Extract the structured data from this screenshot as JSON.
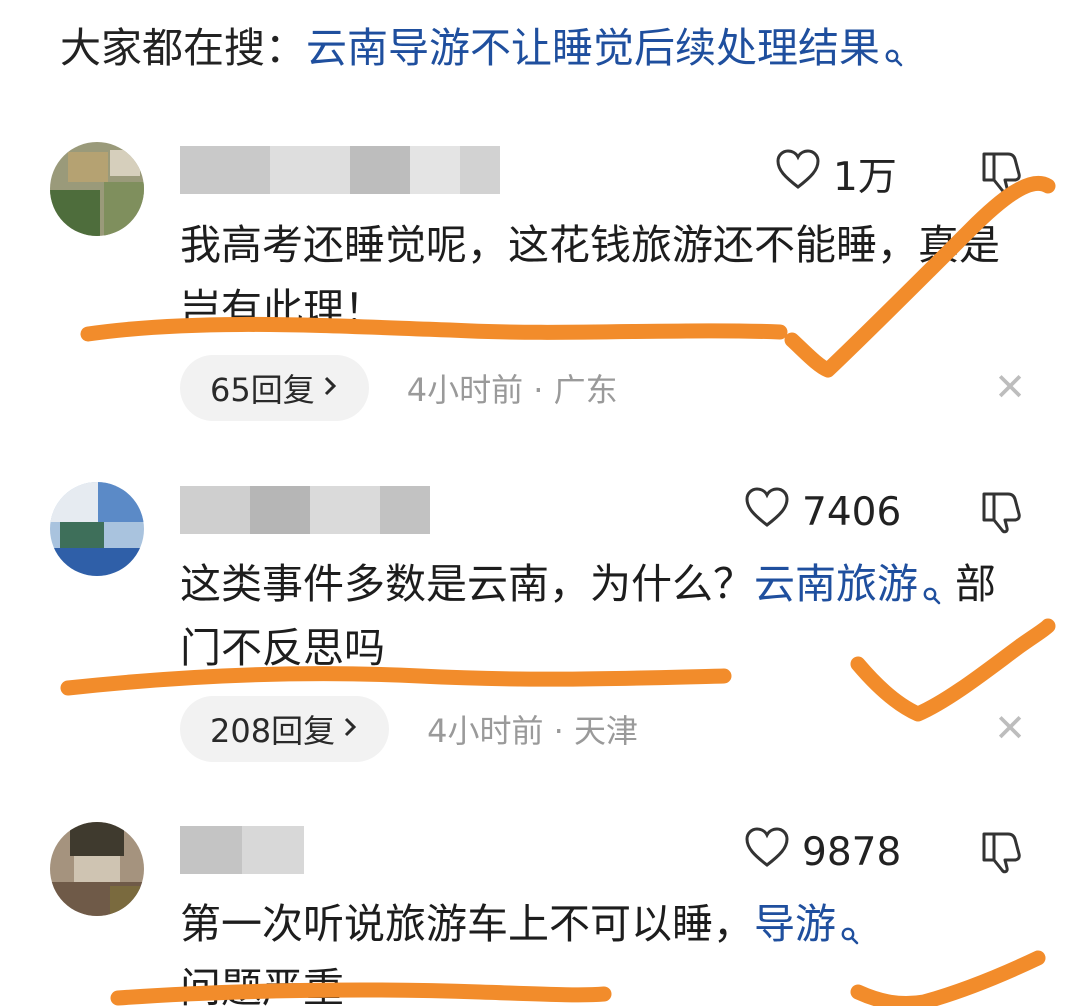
{
  "trending": {
    "prefix": "大家都在搜：",
    "query": "云南导游不让睡觉后续处理结果"
  },
  "comments": [
    {
      "likes": "1万",
      "text": "我高考还睡觉呢，这花钱旅游还不能睡，真是岂有此理！",
      "reply_label": "65回复",
      "time": "4小时前",
      "location": "广东",
      "avatar_colors": [
        "#9a9a7a",
        "#7f8f5d",
        "#b5a272",
        "#4e6d3c",
        "#d6cfbc"
      ]
    },
    {
      "likes": "7406",
      "text_plain": "这类事件多数是云南，为什么？",
      "text_link": "云南旅游",
      "text_tail": "部门不反思吗",
      "reply_label": "208回复",
      "time": "4小时前",
      "location": "天津",
      "avatar_colors": [
        "#5b8ac7",
        "#2f5fa8",
        "#a9c3de",
        "#e6ebf1",
        "#3e6f5a"
      ]
    },
    {
      "likes": "9878",
      "text_plain": "第一次听说旅游车上不可以睡，",
      "text_link": "导游",
      "text_next": "问题严重",
      "avatar_colors": [
        "#6f5a48",
        "#a5937e",
        "#3f3a2e",
        "#cfc4b2",
        "#7a6a3e"
      ]
    }
  ],
  "annotation_color": "#f28c2b",
  "link_color": "#1f4f9e"
}
